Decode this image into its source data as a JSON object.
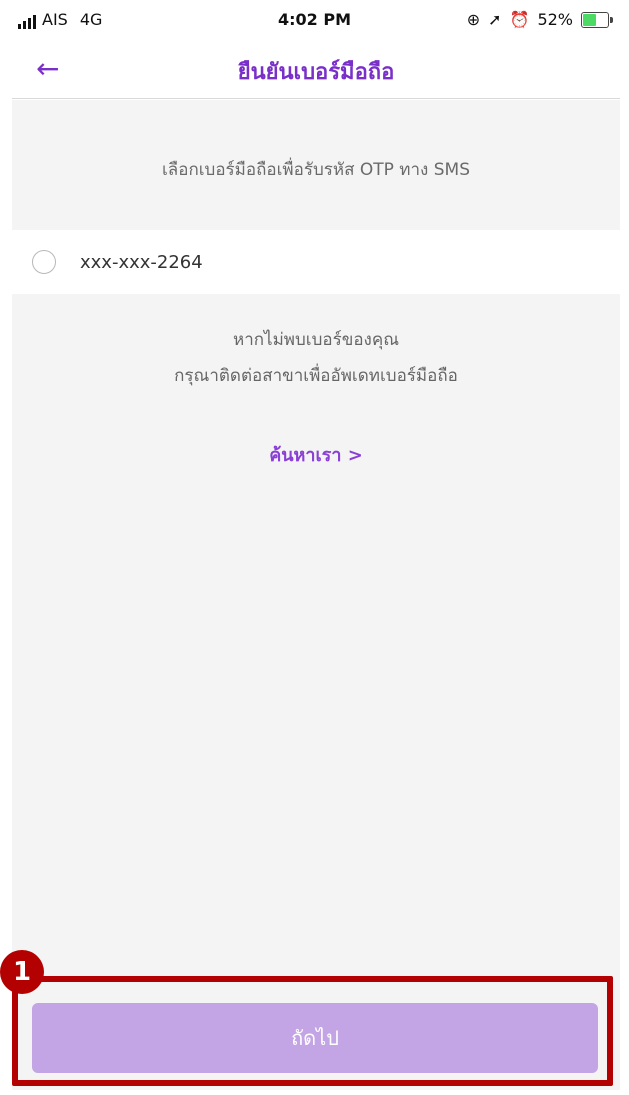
{
  "status_bar": {
    "carrier": "AIS",
    "network": "4G",
    "time": "4:02 PM",
    "battery": "52%"
  },
  "header": {
    "back_icon": "←",
    "title": "ยืนยันเบอร์มือถือ"
  },
  "main": {
    "instruction": "เลือกเบอร์มือถือเพื่อรับรหัส OTP ทาง SMS",
    "phone_option": "xxx-xxx-2264",
    "not_found_line1": "หากไม่พบเบอร์ของคุณ",
    "not_found_line2": "กรุณาติดต่อสาขาเพื่ออัพเดทเบอร์มือถือ",
    "find_us_link": "ค้นหาเรา >"
  },
  "footer": {
    "next_label": "ถัดไป"
  },
  "annotation": {
    "callout_number": "1"
  },
  "colors": {
    "accent": "#7a2fc9",
    "button_disabled": "#c3a4e4",
    "callout": "#b30000"
  }
}
